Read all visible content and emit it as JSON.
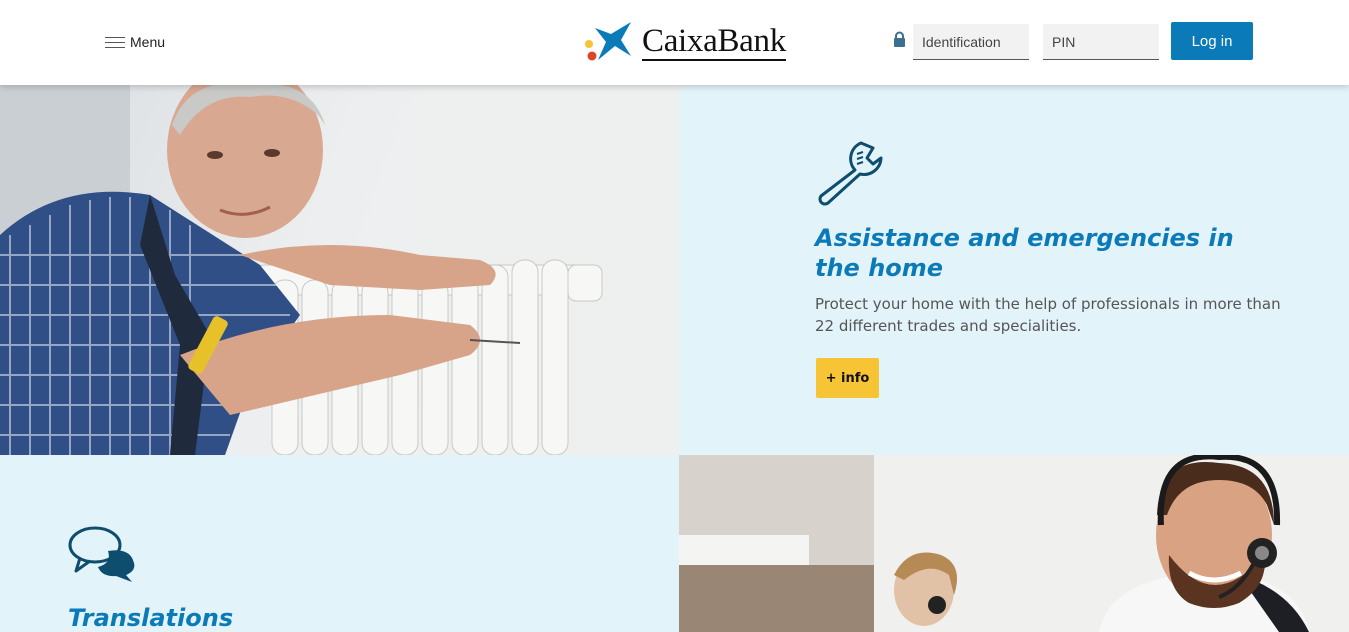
{
  "header": {
    "menu_label": "Menu",
    "logo_text": "CaixaBank",
    "identification_placeholder": "Identification",
    "pin_placeholder": "PIN",
    "login_label": "Log in"
  },
  "sections": [
    {
      "icon": "wrench-icon",
      "title": "Assistance and emergencies in the home",
      "text": "Protect your home with the help of professionals in more than 22 different trades and specialities.",
      "button_label": "+ info",
      "image": "plumber-radiator-photo"
    },
    {
      "icon": "chat-bubbles-icon",
      "title": "Translations",
      "image": "call-center-agent-photo"
    }
  ],
  "colors": {
    "accent_blue": "#0b7ab8",
    "panel_bg": "#e3f3fa",
    "button_yellow": "#f6c434",
    "icon_navy": "#0e4d6e"
  }
}
